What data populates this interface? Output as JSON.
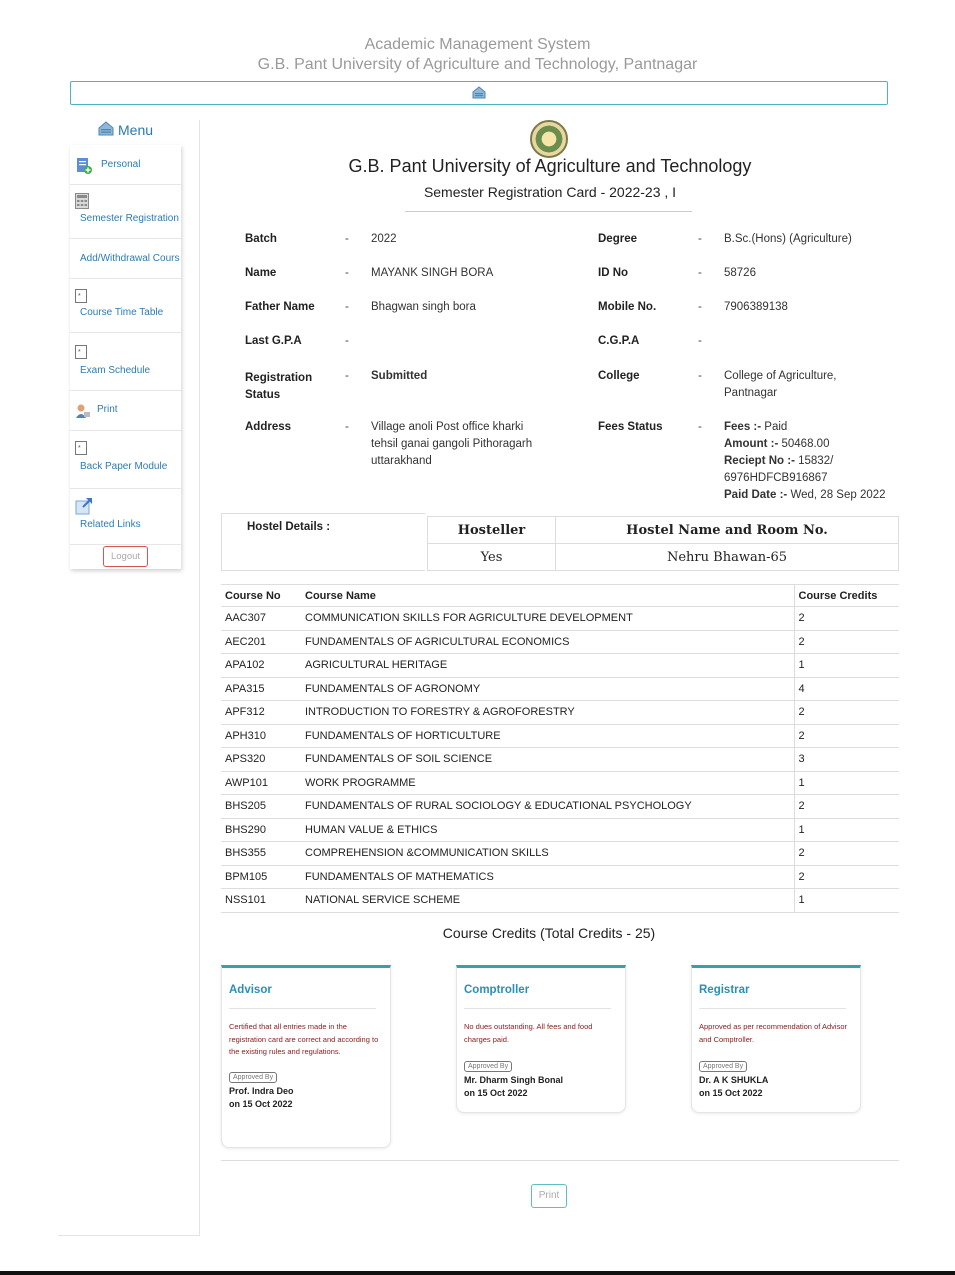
{
  "app": {
    "title": "Academic Management System",
    "subtitle": "G.B. Pant University of Agriculture and Technology, Pantnagar"
  },
  "sidebar": {
    "menu_label": "Menu",
    "items": [
      {
        "label": "Personal",
        "icon": "personal-icon"
      },
      {
        "label": "Semester Registration",
        "icon": "calculator-icon"
      },
      {
        "label": "Add/Withdrawal Course",
        "icon": ""
      },
      {
        "label": "Course Time Table",
        "icon": "document-icon"
      },
      {
        "label": "Exam Schedule",
        "icon": "document-icon"
      },
      {
        "label": "Print",
        "icon": "print-user-icon"
      },
      {
        "label": "Back Paper Module",
        "icon": "document-icon"
      },
      {
        "label": "Related Links",
        "icon": "external-link-icon"
      }
    ],
    "logout_label": "Logout"
  },
  "card": {
    "university": "G.B. Pant University of Agriculture and Technology",
    "title": "Semester Registration Card - 2022-23 , I"
  },
  "student": {
    "left": [
      {
        "label": "Batch",
        "value": "2022"
      },
      {
        "label": "Name",
        "value": "MAYANK SINGH BORA"
      },
      {
        "label": "Father Name",
        "value": "Bhagwan singh bora"
      },
      {
        "label": "Last G.P.A",
        "value": ""
      },
      {
        "label": "Registration Status",
        "value": "Submitted"
      },
      {
        "label": "Address",
        "value": "Village anoli Post office kharki tehsil ganai gangoli Pithoragarh uttarakhand"
      }
    ],
    "right": [
      {
        "label": "Degree",
        "value": "B.Sc.(Hons) (Agriculture)"
      },
      {
        "label": "ID No",
        "value": "58726"
      },
      {
        "label": "Mobile No.",
        "value": "7906389138"
      },
      {
        "label": "C.G.P.A",
        "value": ""
      },
      {
        "label": "College",
        "value": "College of Agriculture, Pantnagar"
      },
      {
        "label": "Fees Status",
        "value": ""
      }
    ],
    "dash": "-",
    "fees": {
      "fees_label": "Fees :-",
      "fees_value": "Paid",
      "amount_label": "Amount :-",
      "amount_value": "50468.00",
      "receipt_label": "Reciept No :-",
      "receipt_value": "15832/",
      "receipt_value2": "6976HDFCB916867",
      "paid_label": "Paid Date :-",
      "paid_value": "Wed, 28 Sep 2022"
    }
  },
  "hostel": {
    "label": "Hostel Details :",
    "headers": [
      "Hosteller",
      "Hostel Name and Room No."
    ],
    "values": [
      "Yes",
      "Nehru Bhawan-65"
    ]
  },
  "courses": {
    "headers": [
      "Course No",
      "Course Name",
      "Course Credits"
    ],
    "rows": [
      [
        "AAC307",
        "COMMUNICATION SKILLS FOR AGRICULTURE DEVELOPMENT",
        "2"
      ],
      [
        "AEC201",
        "FUNDAMENTALS OF AGRICULTURAL ECONOMICS",
        "2"
      ],
      [
        "APA102",
        "AGRICULTURAL HERITAGE",
        "1"
      ],
      [
        "APA315",
        "FUNDAMENTALS OF AGRONOMY",
        "4"
      ],
      [
        "APF312",
        "INTRODUCTION TO FORESTRY & AGROFORESTRY",
        "2"
      ],
      [
        "APH310",
        "FUNDAMENTALS OF HORTICULTURE",
        "2"
      ],
      [
        "APS320",
        "FUNDAMENTALS OF SOIL SCIENCE",
        "3"
      ],
      [
        "AWP101",
        "WORK PROGRAMME",
        "1"
      ],
      [
        "BHS205",
        "FUNDAMENTALS OF RURAL SOCIOLOGY & EDUCATIONAL PSYCHOLOGY",
        "2"
      ],
      [
        "BHS290",
        "HUMAN VALUE & ETHICS",
        "1"
      ],
      [
        "BHS355",
        "COMPREHENSION &COMMUNICATION SKILLS",
        "2"
      ],
      [
        "BPM105",
        "FUNDAMENTALS OF MATHEMATICS",
        "2"
      ],
      [
        "NSS101",
        "NATIONAL SERVICE SCHEME",
        "1"
      ]
    ],
    "total": "Course Credits (Total Credits - 25)"
  },
  "approvals": [
    {
      "role": "Advisor",
      "note": "Certified that all entries made in the registration card are correct and according to the existing rules and regulations.",
      "badge": "Approved By",
      "name": "Prof. Indra Deo",
      "date": "on 15 Oct 2022"
    },
    {
      "role": "Comptroller",
      "note": "No dues outstanding. All fees and food charges paid.",
      "badge": "Approved By",
      "name": "Mr. Dharm Singh Bonal",
      "date": "on 15 Oct 2022"
    },
    {
      "role": "Registrar",
      "note": "Approved as per recommendation of Advisor and Comptroller.",
      "badge": "Approved By",
      "name": "Dr. A K SHUKLA",
      "date": "on 15 Oct 2022"
    }
  ],
  "print_label": "Print",
  "colors": {
    "accent": "#3aa0a8",
    "link": "#2e7bb3",
    "status_green": "#2e9a2e",
    "note_red": "#8b1a1a"
  }
}
